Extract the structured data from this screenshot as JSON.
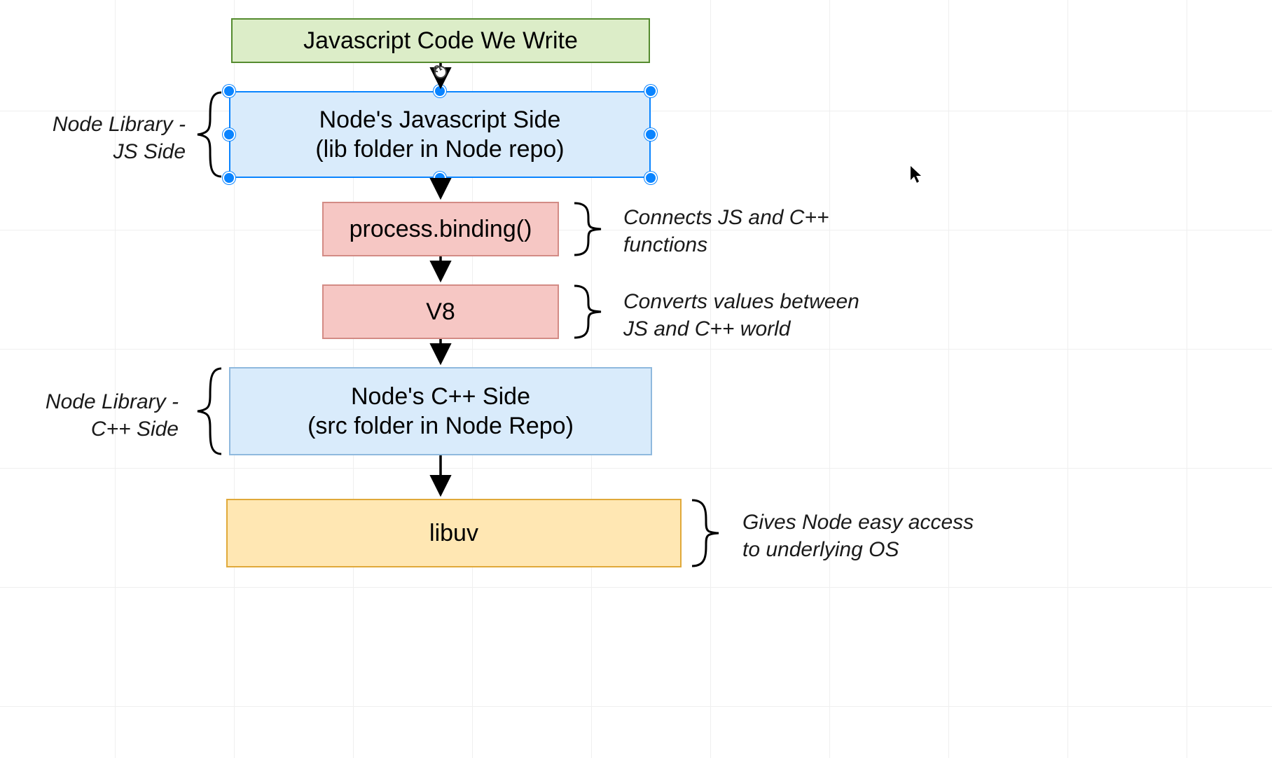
{
  "boxes": {
    "js_code": {
      "line1": "Javascript Code We Write",
      "fill": "#dcedc8",
      "border": "#558b2f"
    },
    "node_js": {
      "line1": "Node's Javascript Side",
      "line2": "(lib folder in Node repo)",
      "fill": "#d9ebfb",
      "border": "#0a84ff",
      "selected": true
    },
    "binding": {
      "line1": "process.binding()",
      "fill": "#f6c7c4",
      "border": "#d38b85"
    },
    "v8": {
      "line1": "V8",
      "fill": "#f6c7c4",
      "border": "#d38b85"
    },
    "node_cpp": {
      "line1": "Node's C++ Side",
      "line2": "(src folder in Node Repo)",
      "fill": "#d9ebfb",
      "border": "#8fb9de"
    },
    "libuv": {
      "line1": "libuv",
      "fill": "#ffe7b3",
      "border": "#e0a93a"
    }
  },
  "annotations": {
    "js_side": {
      "line1": "Node Library -",
      "line2": "JS Side"
    },
    "binding": {
      "line1": "Connects JS and C++",
      "line2": "functions"
    },
    "v8": {
      "line1": "Converts values between",
      "line2": "JS and C++ world"
    },
    "cpp_side": {
      "line1": "Node Library -",
      "line2": "C++ Side"
    },
    "libuv": {
      "line1": "Gives Node easy access",
      "line2": "to underlying OS"
    }
  }
}
